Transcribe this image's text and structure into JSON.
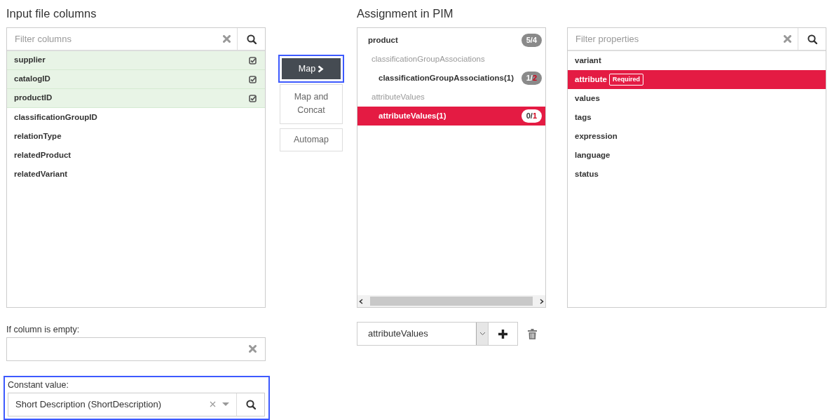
{
  "input_columns": {
    "title": "Input file columns",
    "filter": {
      "placeholder": "Filter columns"
    },
    "items": [
      {
        "label": "supplier",
        "mapped": true
      },
      {
        "label": "catalogID",
        "mapped": true
      },
      {
        "label": "productID",
        "mapped": true
      },
      {
        "label": "classificationGroupID",
        "mapped": false
      },
      {
        "label": "relationType",
        "mapped": false
      },
      {
        "label": "relatedProduct",
        "mapped": false
      },
      {
        "label": "relatedVariant",
        "mapped": false
      }
    ],
    "empty_field": {
      "label": "If column is empty:"
    },
    "constant_field": {
      "label": "Constant value:",
      "value": "Short Description (ShortDescription)",
      "focused": true
    }
  },
  "actions": [
    {
      "label": "Map",
      "kind": "primary",
      "focused": true
    },
    {
      "label": "Map and Concat",
      "kind": "secondary",
      "focused": false
    },
    {
      "label": "Automap",
      "kind": "secondary",
      "focused": false
    }
  ],
  "assignment": {
    "title": "Assignment in PIM",
    "tree": [
      {
        "label": "product",
        "kind": "node",
        "selected": false,
        "badge": {
          "done": "5",
          "sep": "/",
          "total": "4",
          "total_alert": false
        },
        "children": [
          {
            "label": "classificationGroupAssociations",
            "kind": "group",
            "children": [
              {
                "label": "classificationGroupAssociations(1)",
                "kind": "node",
                "selected": false,
                "badge": {
                  "done": "1",
                  "sep": "/",
                  "total": "2",
                  "total_alert": true
                }
              }
            ]
          },
          {
            "label": "attributeValues",
            "kind": "group",
            "children": [
              {
                "label": "attributeValues(1)",
                "kind": "node",
                "selected": true,
                "badge": {
                  "done": "0",
                  "sep": "/",
                  "total": "1",
                  "total_alert": true
                }
              }
            ]
          }
        ]
      }
    ],
    "instance_select": {
      "value": "attributeValues"
    }
  },
  "properties": {
    "filter": {
      "placeholder": "Filter properties"
    },
    "items": [
      {
        "label": "variant",
        "selected": false
      },
      {
        "label": "attribute",
        "selected": true,
        "tag": "Required"
      },
      {
        "label": "values",
        "selected": false
      },
      {
        "label": "tags",
        "selected": false
      },
      {
        "label": "expression",
        "selected": false
      },
      {
        "label": "language",
        "selected": false
      },
      {
        "label": "status",
        "selected": false
      }
    ]
  }
}
